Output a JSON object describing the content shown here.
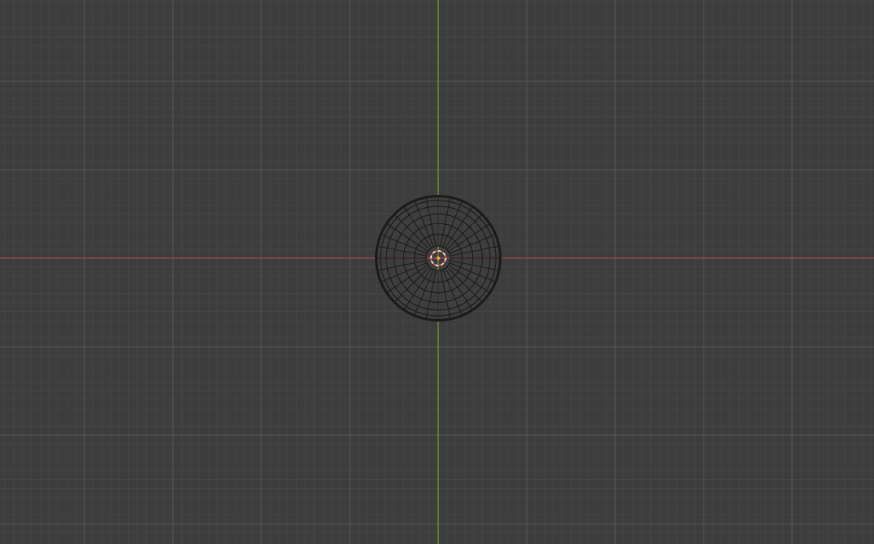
{
  "viewport": {
    "view": "top-orthographic",
    "background_color": "#3d3d3d",
    "grid_minor_color": "#454545",
    "grid_major_color": "#575757",
    "x_axis_color": "#a24a4f",
    "y_axis_color": "#6f9a3a",
    "wireframe_color": "#1a1a1a",
    "origin_color": "#f2a23a",
    "cursor_ring_color": "#e05050",
    "cursor_ring_dash_color": "#ffffff"
  },
  "object": {
    "type": "sphere",
    "display": "wireframe",
    "segments": 32,
    "rings": 16,
    "selected": false
  },
  "cursor_3d": {
    "at_origin": true
  }
}
